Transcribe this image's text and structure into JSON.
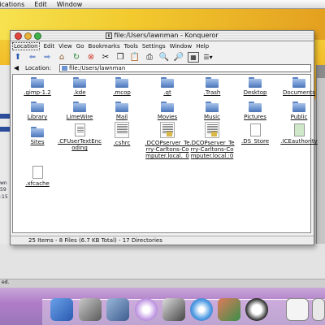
{
  "menubar": {
    "items": [
      "lications",
      "Edit",
      "Window"
    ]
  },
  "window": {
    "title": "file:/Users/lawnman - Konqueror",
    "menu": [
      "Location",
      "Edit",
      "View",
      "Go",
      "Bookmarks",
      "Tools",
      "Settings",
      "Window",
      "Help"
    ],
    "location_label": "Location:",
    "location_value": "file:/Users/lawnman",
    "status": "25 Items - 8 Files (6.7 KB Total) - 17 Directories",
    "items": [
      {
        "label": ".gimp-1.2",
        "type": "folder"
      },
      {
        "label": ".kde",
        "type": "folder"
      },
      {
        "label": ".mcop",
        "type": "folder"
      },
      {
        "label": ".qt",
        "type": "folder"
      },
      {
        "label": ".Trash",
        "type": "folder"
      },
      {
        "label": "Desktop",
        "type": "folder"
      },
      {
        "label": "Documents",
        "type": "folder"
      },
      {
        "label": "Library",
        "type": "folder"
      },
      {
        "label": "LimeWire",
        "type": "folder"
      },
      {
        "label": "Mail",
        "type": "folder"
      },
      {
        "label": "Movies",
        "type": "folder"
      },
      {
        "label": "Music",
        "type": "folder"
      },
      {
        "label": "Pictures",
        "type": "folder"
      },
      {
        "label": "Public",
        "type": "folder"
      },
      {
        "label": "Sites",
        "type": "folder"
      },
      {
        "label": ".CFUserTextEncoding",
        "type": "doc"
      },
      {
        "label": ".cshrc",
        "type": "textdoc"
      },
      {
        "label": ".DCOPserver_Terry-Carltons-Computer.local._0",
        "type": "textdoc"
      },
      {
        "label": ".DCOPserver_Terry-Carltons-Computer.local.:0",
        "type": "textdoc"
      },
      {
        "label": ".DS_Store",
        "type": "doc"
      },
      {
        "label": ".ICEauthority",
        "type": "greendoc"
      },
      {
        "label": ".xfcache",
        "type": "doc"
      }
    ]
  },
  "left_window": {
    "texts": [
      "wn",
      "59",
      ":15",
      "ed."
    ]
  },
  "colors": {
    "close": "#e0443e",
    "minimize": "#e8b23a",
    "zoom": "#3fb24a",
    "folder": "#6d94d0"
  }
}
